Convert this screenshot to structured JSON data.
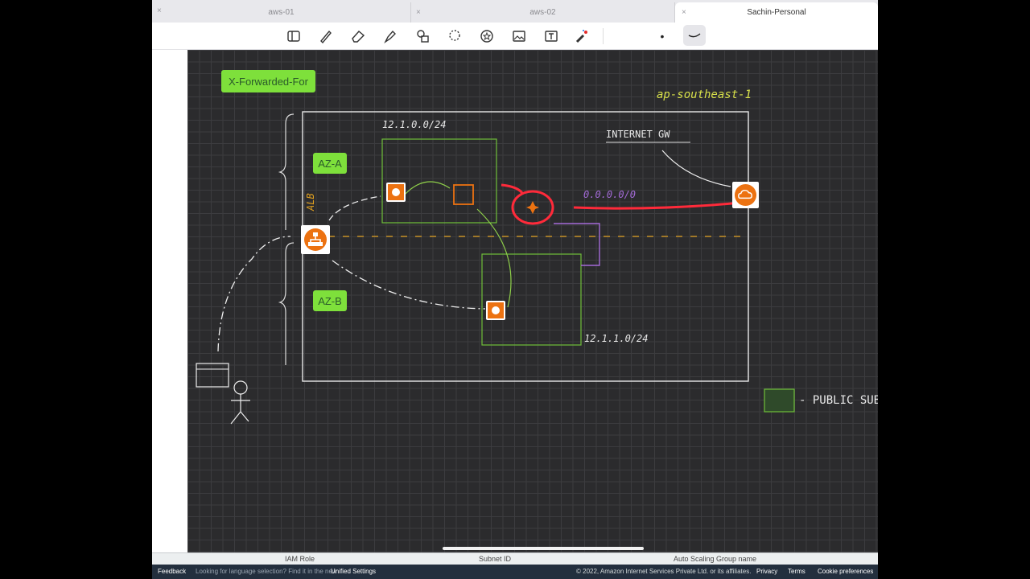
{
  "tabs": [
    {
      "label": "aws-01"
    },
    {
      "label": "aws-02"
    },
    {
      "label": "Sachin-Personal"
    }
  ],
  "toolbar": {
    "tools": [
      "sidebar-icon",
      "pen-icon",
      "eraser-icon",
      "highlighter-icon",
      "shapes-icon",
      "lasso-icon",
      "sticker-icon",
      "image-icon",
      "text-icon",
      "laser-pointer-icon"
    ],
    "stroke_dot": "•"
  },
  "diagram": {
    "header_tag": "X-Forwarded-For",
    "region": "ap-southeast-1",
    "az_a": "AZ-A",
    "az_b": "AZ-B",
    "alb": "ALB",
    "subnet_a_cidr": "12.1.0.0/24",
    "subnet_b_cidr": "12.1.1.0/24",
    "igw_label": "INTERNET GW",
    "route": "0.0.0.0/0",
    "legend_label": "- PUBLIC SUBN",
    "colors": {
      "subnet_green": "#6fbf3a",
      "aws_orange": "#ec7211",
      "neon_red": "#ff2a3a",
      "purple": "#a46bd8",
      "yellow_dash": "#e0a020"
    }
  },
  "console": {
    "columns": [
      "IAM Role",
      "Subnet ID",
      "Auto Scaling Group name"
    ],
    "footer": {
      "feedback": "Feedback",
      "lang_prompt": "Looking for language selection? Find it in the new",
      "unified": "Unified Settings",
      "copyright": "© 2022, Amazon Internet Services Private Ltd. or its affiliates.",
      "privacy": "Privacy",
      "terms": "Terms",
      "cookie": "Cookie preferences"
    }
  }
}
